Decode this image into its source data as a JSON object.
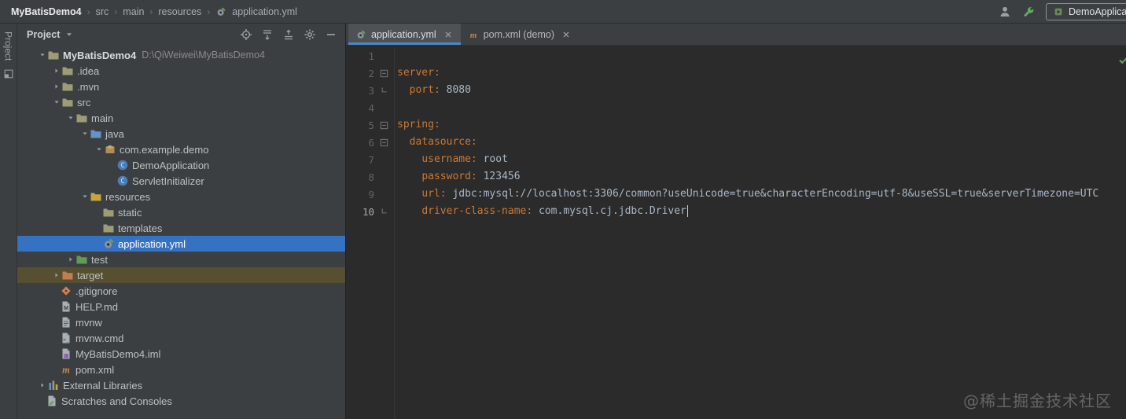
{
  "topbar": {
    "breadcrumb": [
      "MyBatisDemo4",
      "src",
      "main",
      "resources",
      "application.yml"
    ],
    "run_config_label": "DemoApplica"
  },
  "stripe": {
    "label": "Project"
  },
  "project_panel": {
    "title": "Project",
    "tree": [
      {
        "label": "MyBatisDemo4",
        "hint": "D:\\QiWeiwei\\MyBatisDemo4",
        "level": 0,
        "chevron": "down",
        "icon": "project-folder-icon",
        "bold": true
      },
      {
        "label": ".idea",
        "level": 1,
        "chevron": "right",
        "icon": "folder-icon"
      },
      {
        "label": ".mvn",
        "level": 1,
        "chevron": "right",
        "icon": "folder-icon"
      },
      {
        "label": "src",
        "level": 1,
        "chevron": "down",
        "icon": "folder-icon"
      },
      {
        "label": "main",
        "level": 2,
        "chevron": "down",
        "icon": "folder-icon"
      },
      {
        "label": "java",
        "level": 3,
        "chevron": "down",
        "icon": "source-folder-icon"
      },
      {
        "label": "com.example.demo",
        "level": 4,
        "chevron": "down",
        "icon": "package-icon"
      },
      {
        "label": "DemoApplication",
        "level": 5,
        "chevron": "none",
        "icon": "class-icon"
      },
      {
        "label": "ServletInitializer",
        "level": 5,
        "chevron": "none",
        "icon": "class-icon"
      },
      {
        "label": "resources",
        "level": 3,
        "chevron": "down",
        "icon": "resources-folder-icon"
      },
      {
        "label": "static",
        "level": 4,
        "chevron": "none",
        "icon": "folder-icon"
      },
      {
        "label": "templates",
        "level": 4,
        "chevron": "none",
        "icon": "folder-icon"
      },
      {
        "label": "application.yml",
        "level": 4,
        "chevron": "none",
        "icon": "spring-config-icon",
        "selected": true
      },
      {
        "label": "test",
        "level": 2,
        "chevron": "right",
        "icon": "test-folder-icon"
      },
      {
        "label": "target",
        "level": 1,
        "chevron": "right",
        "icon": "excluded-folder-icon",
        "highlighted": true
      },
      {
        "label": ".gitignore",
        "level": 1,
        "chevron": "none",
        "icon": "git-icon"
      },
      {
        "label": "HELP.md",
        "level": 1,
        "chevron": "none",
        "icon": "markdown-icon"
      },
      {
        "label": "mvnw",
        "level": 1,
        "chevron": "none",
        "icon": "text-file-icon"
      },
      {
        "label": "mvnw.cmd",
        "level": 1,
        "chevron": "none",
        "icon": "cmd-file-icon"
      },
      {
        "label": "MyBatisDemo4.iml",
        "level": 1,
        "chevron": "none",
        "icon": "iml-file-icon"
      },
      {
        "label": "pom.xml",
        "level": 1,
        "chevron": "none",
        "icon": "maven-icon"
      },
      {
        "label": "External Libraries",
        "level": 0,
        "chevron": "right",
        "icon": "libraries-icon"
      },
      {
        "label": "Scratches and Consoles",
        "level": 0,
        "chevron": "none",
        "icon": "scratches-icon"
      }
    ]
  },
  "editor": {
    "tabs": [
      {
        "label": "application.yml",
        "icon": "spring-config-icon",
        "active": true
      },
      {
        "label": "pom.xml (demo)",
        "icon": "maven-icon",
        "active": false
      }
    ],
    "lines": [
      {
        "num": "1",
        "fold": "",
        "tokens": []
      },
      {
        "num": "2",
        "fold": "open",
        "tokens": [
          [
            "key",
            "server:"
          ]
        ]
      },
      {
        "num": "3",
        "fold": "end",
        "tokens": [
          [
            "txt",
            "  "
          ],
          [
            "key",
            "port:"
          ],
          [
            "txt",
            " 8080"
          ]
        ]
      },
      {
        "num": "4",
        "fold": "",
        "tokens": []
      },
      {
        "num": "5",
        "fold": "open",
        "tokens": [
          [
            "key",
            "spring:"
          ]
        ]
      },
      {
        "num": "6",
        "fold": "open",
        "tokens": [
          [
            "txt",
            "  "
          ],
          [
            "key",
            "datasource:"
          ]
        ]
      },
      {
        "num": "7",
        "fold": "",
        "tokens": [
          [
            "txt",
            "    "
          ],
          [
            "key",
            "username:"
          ],
          [
            "txt",
            " root"
          ]
        ]
      },
      {
        "num": "8",
        "fold": "",
        "tokens": [
          [
            "txt",
            "    "
          ],
          [
            "key",
            "password:"
          ],
          [
            "txt",
            " 123456"
          ]
        ]
      },
      {
        "num": "9",
        "fold": "",
        "tokens": [
          [
            "txt",
            "    "
          ],
          [
            "key",
            "url:"
          ],
          [
            "txt",
            " jdbc:mysql://localhost:3306/common?useUnicode=true&characterEncoding=utf-8&useSSL=true&serverTimezone=UTC"
          ]
        ]
      },
      {
        "num": "10",
        "fold": "end",
        "cursor": true,
        "tokens": [
          [
            "txt",
            "    "
          ],
          [
            "key",
            "driver-class-name:"
          ],
          [
            "txt",
            " com.mysql.cj.jdbc.Driver"
          ]
        ]
      }
    ]
  },
  "watermark": "@稀土掘金技术社区",
  "colors": {
    "yaml_key": "#cc7832",
    "yaml_value": "#a9b7c6",
    "selection_blue": "#3573c2",
    "target_row_olive": "#575030",
    "tab_underline_blue": "#4a88c7",
    "inspections_ok_green": "#5ca85c"
  }
}
